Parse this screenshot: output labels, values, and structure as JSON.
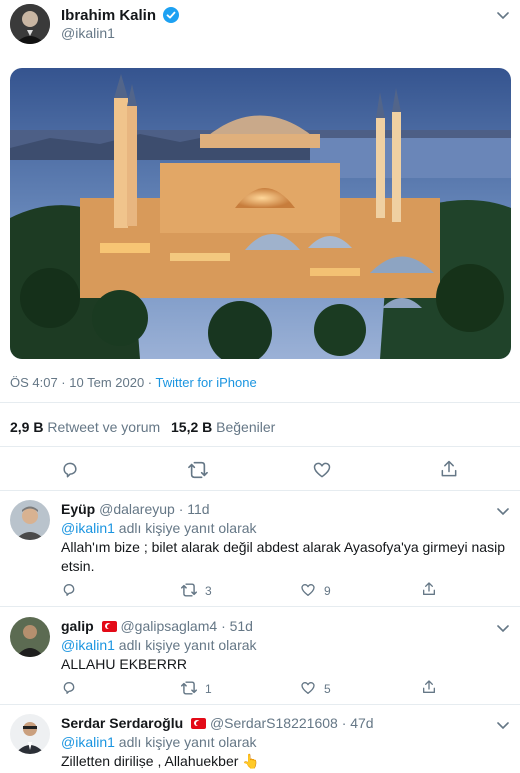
{
  "author": {
    "name": "Ibrahim Kalin",
    "handle": "@ikalin1"
  },
  "tweet": {
    "meta_time": "ÖS 4:07 · 10 Tem 2020 ·",
    "source": "Twitter for iPhone",
    "retweets_count": "2,9 B",
    "retweets_label": "Retweet ve yorum",
    "likes_count": "15,2 B",
    "likes_label": "Beğeniler"
  },
  "colors": {
    "accent": "#1b95e0",
    "verified": "#1da1f2",
    "muted": "#657786"
  },
  "replies": [
    {
      "name": "Eyüp",
      "handle": "@dalareyup",
      "age": "· 11d",
      "reply_to_handle": "@ikalin1",
      "reply_to_suffix": "adlı kişiye yanıt olarak",
      "text_line1": "Allah'ım bize ; bilet alarak değil abdest alarak Ayasofya'ya girmeyi nasip",
      "text_line2": "etsin.",
      "retweet_count": "3",
      "like_count": "9"
    },
    {
      "name": "galip",
      "handle": "@galipsaglam4",
      "age": "· 51d",
      "reply_to_handle": "@ikalin1",
      "reply_to_suffix": "adlı kişiye yanıt olarak",
      "text_line1": "ALLAHU EKBERRR",
      "retweet_count": "1",
      "like_count": "5"
    },
    {
      "name": "Serdar Serdaroğlu",
      "handle": "@SerdarS18221608",
      "age": "· 47d",
      "reply_to_handle": "@ikalin1",
      "reply_to_suffix": "adlı kişiye yanıt olarak",
      "text_line1": "Zilletten diriliṣe , Allahuekber",
      "emoji": "👆"
    }
  ]
}
